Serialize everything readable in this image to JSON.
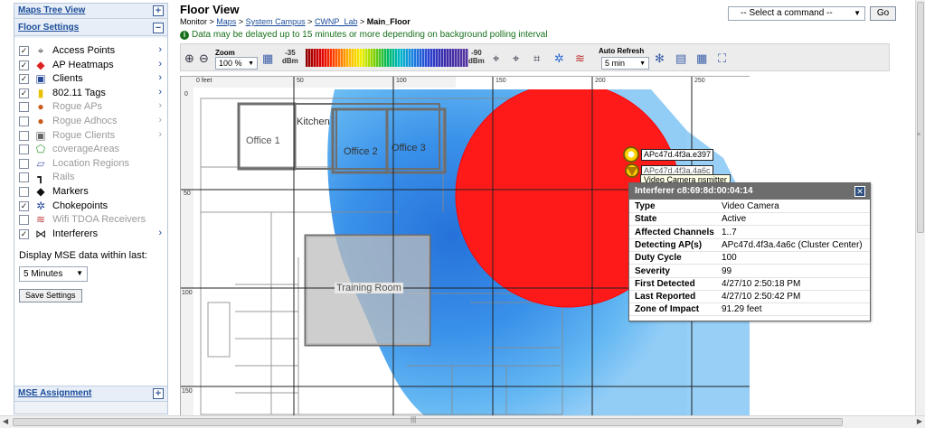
{
  "left_panel": {
    "maps_tree": {
      "label": "Maps Tree View",
      "toggle": "+"
    },
    "floor_settings": {
      "label": "Floor Settings",
      "toggle": "−"
    },
    "layers": [
      {
        "label": "Access Points",
        "checked": "✓",
        "icon": "ap-icon",
        "glyph": "⌖",
        "color": "#444",
        "enabled": true,
        "expand": "›"
      },
      {
        "label": "AP Heatmaps",
        "checked": "✓",
        "icon": "heatmap-icon",
        "glyph": "◆",
        "color": "#d22",
        "enabled": true,
        "expand": "›"
      },
      {
        "label": "Clients",
        "checked": "✓",
        "icon": "client-icon",
        "glyph": "▣",
        "color": "#2a4a9a",
        "enabled": true,
        "expand": "›"
      },
      {
        "label": "802.11 Tags",
        "checked": "✓",
        "icon": "tag-icon",
        "glyph": "▮",
        "color": "#e8c000",
        "enabled": true,
        "expand": "›"
      },
      {
        "label": "Rogue APs",
        "checked": "",
        "icon": "rogue-ap-icon",
        "glyph": "●",
        "color": "#c85a1a",
        "enabled": false,
        "expand": "›"
      },
      {
        "label": "Rogue Adhocs",
        "checked": "",
        "icon": "rogue-adhoc-icon",
        "glyph": "●",
        "color": "#c85a1a",
        "enabled": false,
        "expand": "›"
      },
      {
        "label": "Rogue Clients",
        "checked": "",
        "icon": "rogue-client-icon",
        "glyph": "▣",
        "color": "#666",
        "enabled": false,
        "expand": "›"
      },
      {
        "label": "coverageAreas",
        "checked": "",
        "icon": "coverage-icon",
        "glyph": "⬠",
        "color": "#3a9a3a",
        "enabled": false,
        "expand": ""
      },
      {
        "label": "Location Regions",
        "checked": "",
        "icon": "region-icon",
        "glyph": "▱",
        "color": "#5a6abf",
        "enabled": false,
        "expand": ""
      },
      {
        "label": "Rails",
        "checked": "",
        "icon": "rail-icon",
        "glyph": "┓",
        "color": "#222",
        "enabled": false,
        "expand": ""
      },
      {
        "label": "Markers",
        "checked": "",
        "icon": "marker-icon",
        "glyph": "◆",
        "color": "#111",
        "enabled": true,
        "expand": ""
      },
      {
        "label": "Chokepoints",
        "checked": "✓",
        "icon": "chokepoint-icon",
        "glyph": "✲",
        "color": "#2a4a9a",
        "enabled": true,
        "expand": ""
      },
      {
        "label": "Wifi TDOA Receivers",
        "checked": "",
        "icon": "tdoa-icon",
        "glyph": "≋",
        "color": "#c04040",
        "enabled": false,
        "expand": ""
      },
      {
        "label": "Interferers",
        "checked": "✓",
        "icon": "interferer-icon",
        "glyph": "⋈",
        "color": "#222",
        "enabled": true,
        "expand": "›"
      }
    ],
    "mse_label": "Display MSE data within last:",
    "mse_value": "5 Minutes",
    "save_label": "Save Settings",
    "mse_assignment": {
      "label": "MSE Assignment",
      "toggle": "+"
    }
  },
  "header": {
    "title": "Floor View",
    "breadcrumb": {
      "monitor": "Monitor >",
      "maps": "Maps",
      "sep1": ">",
      "campus": "System Campus",
      "sep2": ">",
      "lab": "CWNP_Lab",
      "sep3": ">",
      "floor": "Main_Floor"
    },
    "notice": "Data may be delayed up to 15 minutes or more depending on background polling interval",
    "command_placeholder": "-- Select a command --",
    "go_label": "Go"
  },
  "toolbar": {
    "zoom_label": "Zoom",
    "zoom_value": "100 %",
    "dbm_high_value": "-35",
    "dbm_low_value": "-90",
    "dbm_unit": "dBm",
    "refresh_label": "Auto Refresh",
    "refresh_value": "5 min"
  },
  "map": {
    "ruler_x": [
      "0 feet",
      "50",
      "100",
      "150",
      "200",
      "250"
    ],
    "ruler_y": [
      "0",
      "50",
      "100",
      "150"
    ],
    "rooms": {
      "office1": "Office 1",
      "kitchen": "Kitchen",
      "office2": "Office 2",
      "office3": "Office 3",
      "training": "Training Room"
    },
    "ap1_label": "APc47d.4f3a.e397",
    "ap2_label": "APc47d.4f3a.4a6c",
    "interferer_tooltip": "Video Camera",
    "interferer_tooltip_suffix": "nsmitter",
    "zone_color": "#ff1a1a",
    "heat_color": "#3aa8f0"
  },
  "popup": {
    "title": "Interferer c8:69:8d:00:04:14",
    "close": "✕",
    "rows": [
      {
        "k": "Type",
        "v": "Video Camera"
      },
      {
        "k": "State",
        "v": "Active"
      },
      {
        "k": "Affected Channels",
        "v": "1..7"
      },
      {
        "k": "Detecting AP(s)",
        "v": "APc47d.4f3a.4a6c (Cluster Center)"
      },
      {
        "k": "Duty Cycle",
        "v": "100"
      },
      {
        "k": "Severity",
        "v": "99"
      },
      {
        "k": "First Detected",
        "v": "4/27/10 2:50:18 PM"
      },
      {
        "k": "Last Reported",
        "v": "4/27/10 2:50:42 PM"
      },
      {
        "k": "Zone of Impact",
        "v": "91.29 feet"
      }
    ]
  }
}
